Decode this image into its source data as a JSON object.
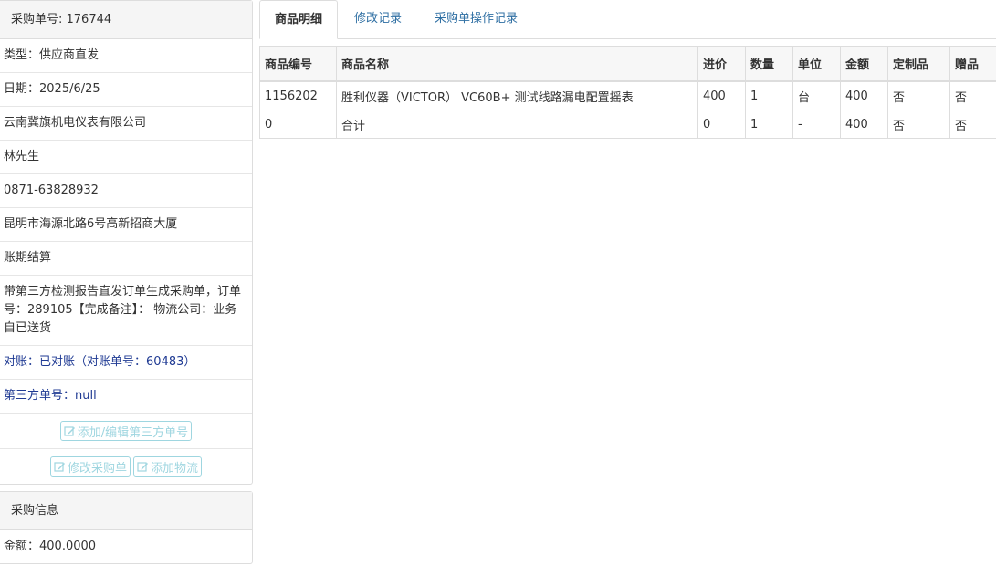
{
  "order_info": {
    "header": "采购单号: 176744",
    "type": "类型：供应商直发",
    "date": "日期：2025/6/25",
    "supplier": "云南冀旗机电仪表有限公司",
    "contact": "林先生",
    "phone": "0871-63828932",
    "address": "昆明市海源北路6号高新招商大厦",
    "payment": "账期结算",
    "remark": "带第三方检测报告直发订单生成采购单，订单号：289105【完成备注】： 物流公司：业务自已送货",
    "reconciliation": "对账：已对账（对账单号：60483）",
    "third_party_no": "第三方单号：null",
    "buttons": {
      "edit_third_party": "添加/编辑第三方单号",
      "modify_order": "修改采购单",
      "add_logistics": "添加物流"
    }
  },
  "purchase_info": {
    "header": "采购信息",
    "amount": "金额：400.0000"
  },
  "tabs": [
    "商品明细",
    "修改记录",
    "采购单操作记录"
  ],
  "table": {
    "headers": [
      "商品编号",
      "商品名称",
      "进价",
      "数量",
      "单位",
      "金额",
      "定制品",
      "赠品"
    ],
    "rows": [
      [
        "1156202",
        "胜利仪器（VICTOR） VC60B+ 测试线路漏电配置摇表",
        "400",
        "1",
        "台",
        "400",
        "否",
        "否"
      ],
      [
        "0",
        "合计",
        "0",
        "1",
        "-",
        "400",
        "否",
        "否"
      ]
    ]
  }
}
